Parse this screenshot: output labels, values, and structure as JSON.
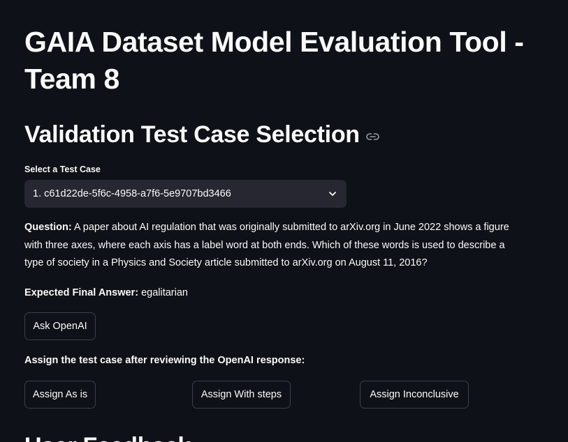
{
  "app": {
    "title": "GAIA Dataset Model Evaluation Tool - Team 8"
  },
  "section": {
    "heading": "Validation Test Case Selection",
    "anchor_icon": "link-icon"
  },
  "test_case_select": {
    "label": "Select a Test Case",
    "selected_value": "1. c61d22de-5f6c-4958-a7f6-5e9707bd3466",
    "icon": "chevron-down-icon"
  },
  "question": {
    "label": "Question:",
    "text": "A paper about AI regulation that was originally submitted to arXiv.org in June 2022 shows a figure with three axes, where each axis has a label word at both ends. Which of these words is used to describe a type of society in a Physics and Society article submitted to arXiv.org on August 11, 2016?"
  },
  "expected_answer": {
    "label": "Expected Final Answer:",
    "value": "egalitarian"
  },
  "actions": {
    "ask_label": "Ask OpenAI",
    "assign_prompt": "Assign the test case after reviewing the OpenAI response:",
    "assign_as_is": "Assign As is",
    "assign_with_steps": "Assign With steps",
    "assign_inconclusive": "Assign Inconclusive"
  },
  "next_section": {
    "heading": "User Feedback"
  },
  "colors": {
    "background": "#0e1117",
    "text": "#fafafa",
    "select_background": "#262730",
    "button_border": "#3d3f4b"
  }
}
